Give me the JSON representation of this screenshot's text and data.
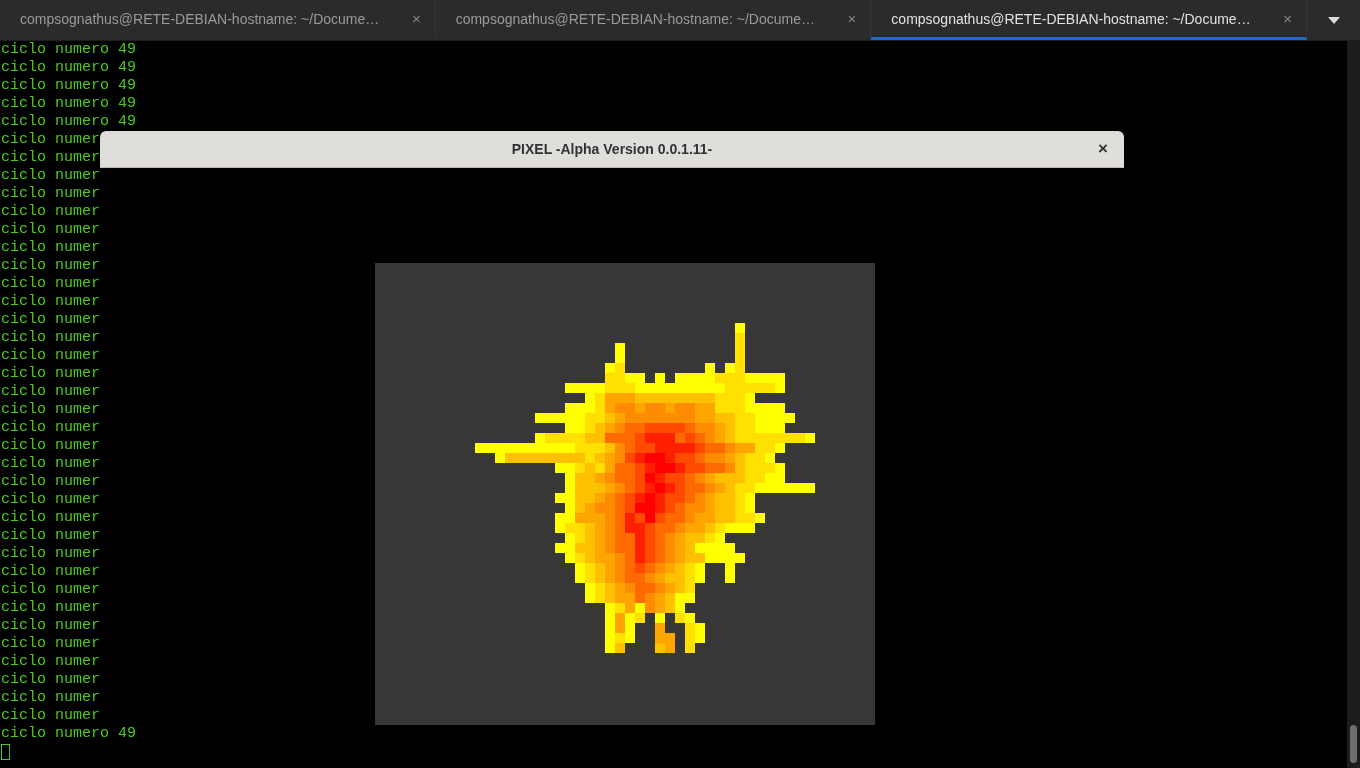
{
  "tabs": [
    {
      "label": "compsognathus@RETE-DEBIAN-hostname: ~/Docume…",
      "close": "×",
      "selected": false
    },
    {
      "label": "compsognathus@RETE-DEBIAN-hostname: ~/Docume…",
      "close": "×",
      "selected": false
    },
    {
      "label": "compsognathus@RETE-DEBIAN-hostname: ~/Docume…",
      "close": "×",
      "selected": true
    }
  ],
  "terminal": {
    "lines": [
      "ciclo numero 49",
      "ciclo numero 49",
      "ciclo numero 49",
      "ciclo numero 49",
      "ciclo numero 49",
      "ciclo numer",
      "ciclo numer",
      "ciclo numer",
      "ciclo numer",
      "ciclo numer",
      "ciclo numer",
      "ciclo numer",
      "ciclo numer",
      "ciclo numer",
      "ciclo numer",
      "ciclo numer",
      "ciclo numer",
      "ciclo numer",
      "ciclo numer",
      "ciclo numer",
      "ciclo numer",
      "ciclo numer",
      "ciclo numer",
      "ciclo numer",
      "ciclo numer",
      "ciclo numer",
      "ciclo numer",
      "ciclo numer",
      "ciclo numer",
      "ciclo numer",
      "ciclo numer",
      "ciclo numer",
      "ciclo numer",
      "ciclo numer",
      "ciclo numer",
      "ciclo numer",
      "ciclo numer",
      "ciclo numer",
      "ciclo numero 49"
    ]
  },
  "window": {
    "title": "PIXEL -Alpha Version 0.0.1.11-",
    "close": "×"
  }
}
